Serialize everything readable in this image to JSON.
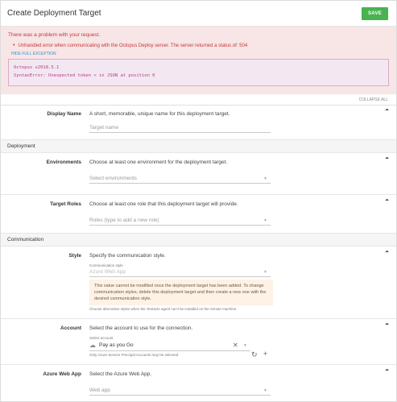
{
  "header": {
    "title": "Create Deployment Target",
    "save_label": "SAVE"
  },
  "error": {
    "title": "There was a problem with your request.",
    "items": [
      "Unhandled error when communicating with the Octopus Deploy server. The server returned a status of: 504"
    ],
    "hide_link": "HIDE FULL EXCEPTION",
    "exception_lines": [
      "Octopus v2018.5.1",
      "SyntaxError: Unexpected token < in JSON at position 0"
    ]
  },
  "collapse_all": "COLLAPSE ALL",
  "display_name": {
    "label": "Display Name",
    "description": "A short, memorable, unique name for this deployment target.",
    "placeholder": "Target name"
  },
  "deployment_group": "Deployment",
  "environments": {
    "label": "Environments",
    "description": "Choose at least one environment for the deployment target.",
    "placeholder": "Select environments"
  },
  "target_roles": {
    "label": "Target Roles",
    "description": "Choose at least one role that this deployment target will provide.",
    "placeholder": "Roles (type to add a new role)"
  },
  "communication_group": "Communication",
  "style": {
    "label": "Style",
    "description": "Specify the communication style.",
    "field_label": "Communication style",
    "value": "Azure Web App",
    "notice": "This value cannot be modified once the deployment target has been added. To change communication styles, delete this deployment target and then create a new one with the desired communication style.",
    "hint": "Choose alternative styles when the Tentacle agent can't be installed on the remote machine."
  },
  "account": {
    "label": "Account",
    "description": "Select the account to use for the connection.",
    "field_label": "Select account",
    "value": "Pay as you Go",
    "hint": "Only Azure Service Principal Accounts may be selected."
  },
  "azure_web_app": {
    "label": "Azure Web App",
    "description": "Select the Azure Web App.",
    "placeholder": "Web app"
  }
}
